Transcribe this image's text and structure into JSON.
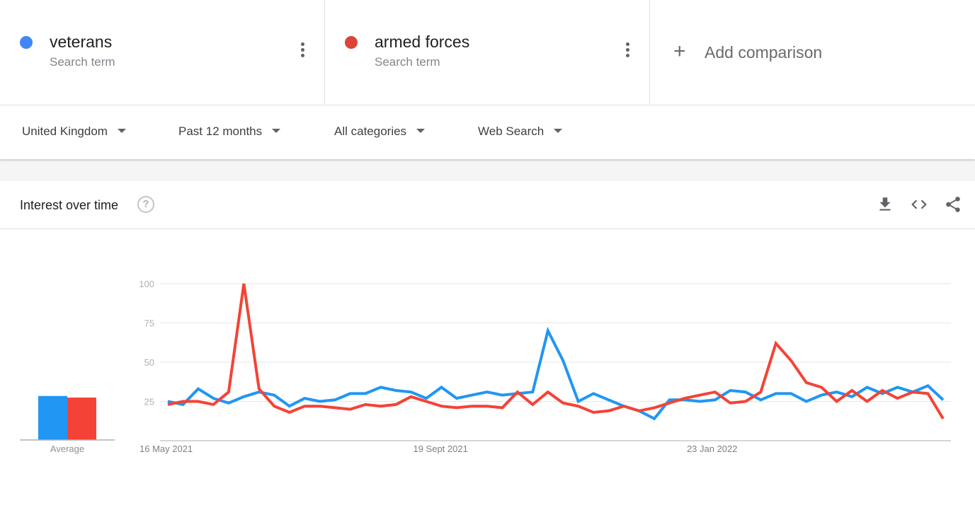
{
  "terms": [
    {
      "name": "veterans",
      "subtitle": "Search term",
      "color": "#4285f4"
    },
    {
      "name": "armed forces",
      "subtitle": "Search term",
      "color": "#db4437"
    }
  ],
  "add_comparison": {
    "icon": "plus-icon",
    "label": "Add comparison"
  },
  "filters": [
    {
      "label": "United Kingdom"
    },
    {
      "label": "Past 12 months"
    },
    {
      "label": "All categories"
    },
    {
      "label": "Web Search"
    }
  ],
  "card": {
    "title": "Interest over time",
    "help_icon": "?",
    "tools": [
      "download-icon",
      "embed-code-icon",
      "share-icon"
    ]
  },
  "chart_data": {
    "type": "line",
    "title": "Interest over time",
    "xlabel": "",
    "ylabel": "",
    "ylim": [
      0,
      100
    ],
    "yticks": [
      25,
      50,
      75,
      100
    ],
    "grid": true,
    "x_tick_labels": [
      {
        "index": 0,
        "label": "16 May 2021"
      },
      {
        "index": 18,
        "label": "19 Sept 2021"
      },
      {
        "index": 36,
        "label": "23 Jan 2022"
      }
    ],
    "x_count": 52,
    "series": [
      {
        "name": "veterans",
        "color": "#2196f3",
        "values": [
          25,
          23,
          33,
          27,
          24,
          28,
          31,
          29,
          22,
          27,
          25,
          26,
          30,
          30,
          34,
          32,
          31,
          27,
          34,
          27,
          29,
          31,
          29,
          30,
          31,
          70,
          51,
          25,
          30,
          26,
          22,
          19,
          14,
          26,
          26,
          25,
          26,
          32,
          31,
          26,
          30,
          30,
          25,
          29,
          31,
          28,
          34,
          30,
          34,
          31,
          35,
          26
        ]
      },
      {
        "name": "armed forces",
        "color": "#f44336",
        "values": [
          23,
          25,
          25,
          23,
          31,
          100,
          33,
          22,
          18,
          22,
          22,
          21,
          20,
          23,
          22,
          23,
          28,
          25,
          22,
          21,
          22,
          22,
          21,
          31,
          23,
          31,
          24,
          22,
          18,
          19,
          22,
          19,
          21,
          24,
          27,
          29,
          31,
          24,
          25,
          31,
          62,
          51,
          37,
          34,
          25,
          32,
          25,
          32,
          27,
          31,
          30,
          14
        ]
      }
    ],
    "average": {
      "label": "Average",
      "values": [
        {
          "name": "veterans",
          "value": 28
        },
        {
          "name": "armed forces",
          "value": 27
        }
      ]
    }
  }
}
